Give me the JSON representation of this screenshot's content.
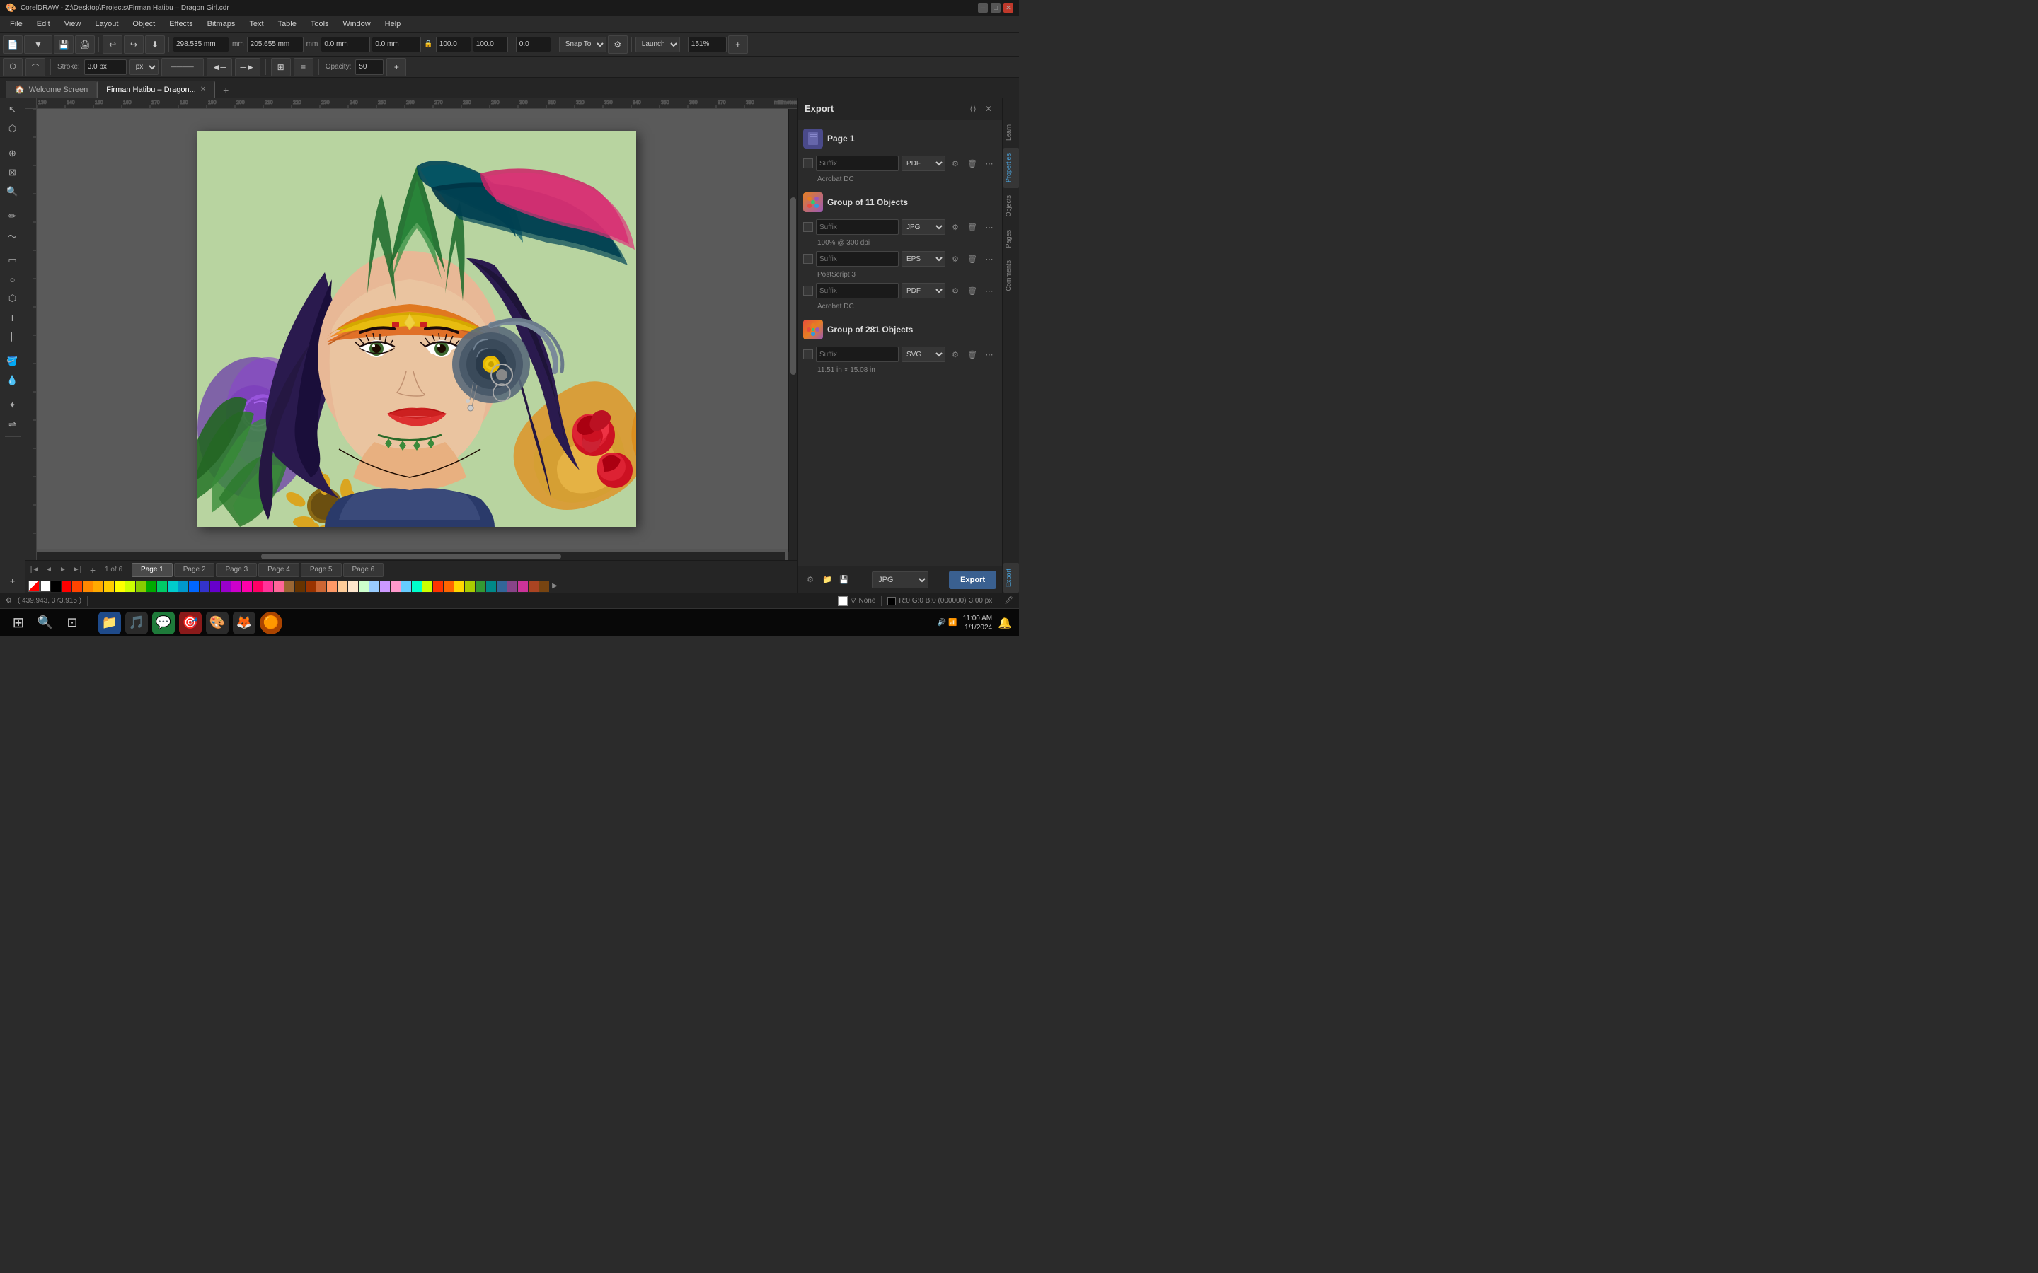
{
  "titlebar": {
    "title": "CorelDRAW - Z:\\Desktop\\Projects\\Firman Hatibu – Dragon Girl.cdr",
    "controls": [
      "minimize",
      "maximize",
      "close"
    ]
  },
  "menubar": {
    "items": [
      "File",
      "Edit",
      "View",
      "Layout",
      "Object",
      "Effects",
      "Bitmaps",
      "Text",
      "Table",
      "Tools",
      "Window",
      "Help"
    ]
  },
  "toolbar1": {
    "snap_label": "Snap To",
    "launch_label": "Launch",
    "zoom_level": "151%",
    "coord_x": "298.535 mm",
    "coord_y": "205.655 mm",
    "size_w": "0.0 mm",
    "size_h": "0.0 mm",
    "val_100_1": "100.0",
    "val_100_2": "100.0",
    "rotation": "0.0"
  },
  "toolbar2": {
    "stroke_size": "3.0 px",
    "opacity_value": "50"
  },
  "tabs": {
    "home": {
      "label": "Welcome Screen",
      "icon": "🏠"
    },
    "active": {
      "label": "Firman Hatibu – Dragon...",
      "closeable": true
    }
  },
  "canvas": {
    "background_color": "#b8d4a0"
  },
  "export_panel": {
    "title": "Export",
    "page1": {
      "name": "Page 1",
      "rows": [
        {
          "suffix_placeholder": "Suffix",
          "format": "PDF",
          "info": "Acrobat DC"
        }
      ]
    },
    "group11": {
      "name": "Group of 11 Objects",
      "rows": [
        {
          "suffix_placeholder": "Suffix",
          "format": "JPG",
          "info": "100% @ 300 dpi"
        },
        {
          "suffix_placeholder": "Suffix",
          "format": "EPS",
          "info": "PostScript 3"
        },
        {
          "suffix_placeholder": "Suffix",
          "format": "PDF",
          "info": "Acrobat DC"
        }
      ]
    },
    "group281": {
      "name": "Group of 281 Objects",
      "rows": [
        {
          "suffix_placeholder": "Suffix",
          "format": "SVG",
          "info": "11.51 in × 15.08 in"
        }
      ]
    },
    "footer": {
      "format": "JPG",
      "export_button": "Export"
    }
  },
  "side_tabs": {
    "items": [
      "Learn",
      "Properties",
      "Objects",
      "Pages",
      "Comments"
    ],
    "export_tab": "Export"
  },
  "page_tabs": {
    "current_page": 1,
    "total_pages": 6,
    "pages": [
      "Page 1",
      "Page 2",
      "Page 3",
      "Page 4",
      "Page 5",
      "Page 6"
    ]
  },
  "status_bar": {
    "coords": "( 439.943, 373.915 )",
    "fill_label": "None",
    "color_info": "R:0 G:0 B:0 (000000)",
    "stroke_size": "3.00 px"
  },
  "palette_colors": [
    "#FFFFFF",
    "#000000",
    "#FF0000",
    "#FF6600",
    "#FFCC00",
    "#FFFF00",
    "#99CC00",
    "#00AA00",
    "#00CCCC",
    "#0066FF",
    "#6600CC",
    "#CC00CC",
    "#FF6699",
    "#996633",
    "#663300",
    "#FF9966",
    "#FFCC99",
    "#CCFFCC",
    "#99CCFF",
    "#CC99FF",
    "#FF99CC",
    "#66CCFF",
    "#00FFCC",
    "#CCFF00",
    "#FF3300",
    "#FF9900",
    "#FFFF99",
    "#CCFFFF",
    "#003366",
    "#330033",
    "#660000",
    "#CC3300",
    "#FF6600",
    "#FFCC33",
    "#99FF00",
    "#33CC33",
    "#009999",
    "#3366CC",
    "#9933CC",
    "#FF33CC",
    "#FF6666",
    "#FFCC66",
    "#99FF66",
    "#33FFCC",
    "#66CCCC",
    "#9999FF",
    "#CC66FF",
    "#FF99FF",
    "#FF3366",
    "#CC6600"
  ],
  "taskbar": {
    "icons": [
      "⊞",
      "🔍",
      "🗂",
      "🎵",
      "🟢",
      "🎯",
      "🦊",
      "🟠"
    ],
    "time": "...",
    "date": "..."
  }
}
